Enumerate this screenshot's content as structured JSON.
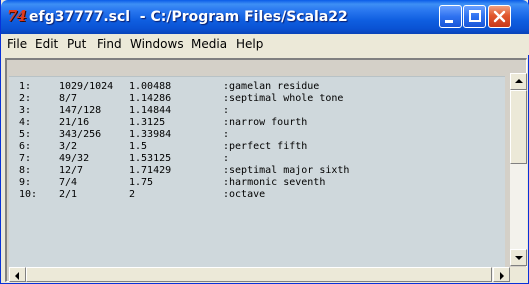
{
  "window": {
    "icon_text": "74",
    "title": "efg37777.scl  - C:/Program Files/Scala22"
  },
  "menu": [
    {
      "label": "File"
    },
    {
      "label": "Edit"
    },
    {
      "label": "Put"
    },
    {
      "label": "Find"
    },
    {
      "label": "Windows"
    },
    {
      "label": "Media"
    },
    {
      "label": "Help"
    }
  ],
  "scale_rows": [
    {
      "index": "1:",
      "ratio": "1029/1024",
      "cents": "1.00488",
      "name": ":gamelan residue"
    },
    {
      "index": "2:",
      "ratio": "8/7",
      "cents": "1.14286",
      "name": ":septimal whole tone"
    },
    {
      "index": "3:",
      "ratio": "147/128",
      "cents": "1.14844",
      "name": ":"
    },
    {
      "index": "4:",
      "ratio": "21/16",
      "cents": "1.3125",
      "name": ":narrow fourth"
    },
    {
      "index": "5:",
      "ratio": "343/256",
      "cents": "1.33984",
      "name": ":"
    },
    {
      "index": "6:",
      "ratio": "3/2",
      "cents": "1.5",
      "name": ":perfect fifth"
    },
    {
      "index": "7:",
      "ratio": "49/32",
      "cents": "1.53125",
      "name": ":"
    },
    {
      "index": "8:",
      "ratio": "12/7",
      "cents": "1.71429",
      "name": ":septimal major sixth"
    },
    {
      "index": "9:",
      "ratio": "7/4",
      "cents": "1.75",
      "name": ":harmonic seventh"
    },
    {
      "index": "10:",
      "ratio": "2/1",
      "cents": "2",
      "name": ":octave"
    }
  ],
  "colors": {
    "titlebar": "#0a52d3",
    "text_background": "#cfd8dc",
    "close_button": "#e1582e"
  }
}
